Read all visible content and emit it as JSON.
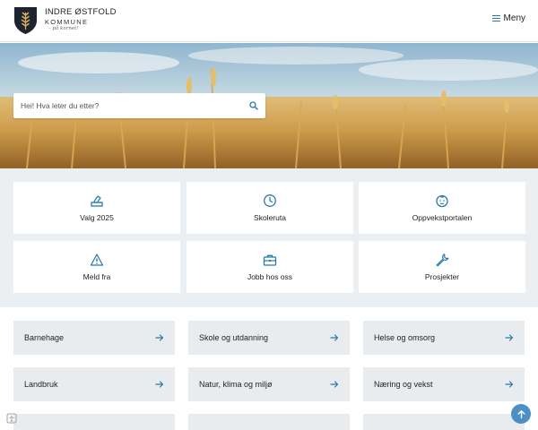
{
  "header": {
    "org_name": "INDRE ØSTFOLD",
    "org_sub": "KOMMUNE",
    "tagline": "– på kornet!",
    "menu_label": "Meny"
  },
  "search": {
    "placeholder": "Hei! Hva leter du etter?"
  },
  "quick_links": [
    {
      "label": "Valg 2025",
      "icon": "ballot-box-icon"
    },
    {
      "label": "Skoleruta",
      "icon": "clock-icon"
    },
    {
      "label": "Oppvekstportalen",
      "icon": "child-face-icon"
    },
    {
      "label": "Meld fra",
      "icon": "warning-icon"
    },
    {
      "label": "Jobb hos oss",
      "icon": "briefcase-icon"
    },
    {
      "label": "Prosjekter",
      "icon": "wrench-icon"
    }
  ],
  "topics": [
    {
      "label": "Barnehage"
    },
    {
      "label": "Skole og utdanning"
    },
    {
      "label": "Helse og omsorg"
    },
    {
      "label": "Landbruk"
    },
    {
      "label": "Natur, klima og miljø"
    },
    {
      "label": "Næring og vekst"
    }
  ],
  "colors": {
    "accent": "#2a7aa8",
    "quick_bg": "#eceff2",
    "topic_bg": "#e9ecef",
    "to_top": "#4b8fc4"
  }
}
